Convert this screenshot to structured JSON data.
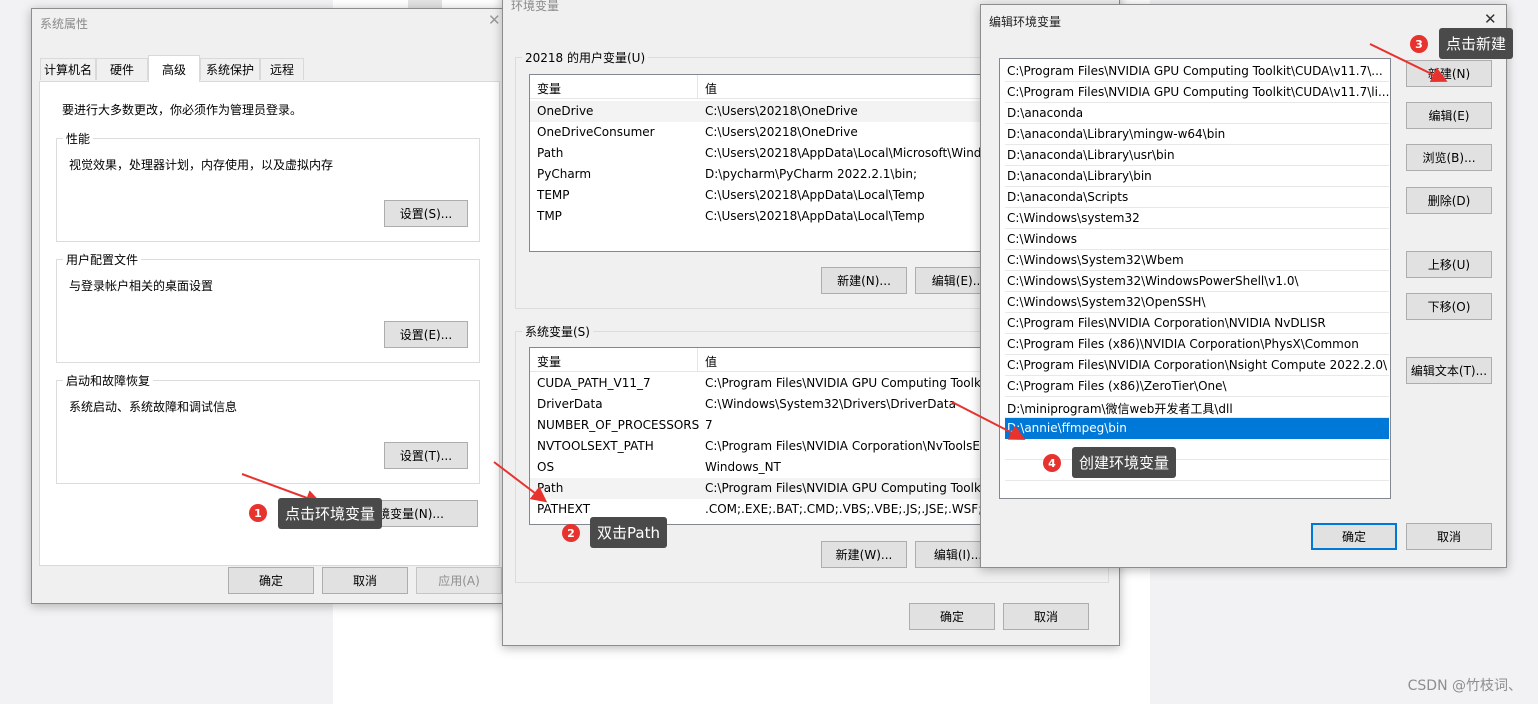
{
  "colors": {
    "accent": "#0078d7",
    "annotation_red": "#e7322d",
    "callout_bg": "#4a4a4a"
  },
  "sys_props": {
    "title": "系统属性",
    "tabs": [
      "计算机名",
      "硬件",
      "高级",
      "系统保护",
      "远程"
    ],
    "active_tab": "高级",
    "admin_note": "要进行大多数更改，你必须作为管理员登录。",
    "performance": {
      "label": "性能",
      "desc": "视觉效果，处理器计划，内存使用，以及虚拟内存",
      "button": "设置(S)..."
    },
    "user_profiles": {
      "label": "用户配置文件",
      "desc": "与登录帐户相关的桌面设置",
      "button": "设置(E)..."
    },
    "startup": {
      "label": "启动和故障恢复",
      "desc": "系统启动、系统故障和调试信息",
      "button": "设置(T)..."
    },
    "env_button": "环境变量(N)...",
    "ok": "确定",
    "cancel": "取消",
    "apply": "应用(A)"
  },
  "env_vars": {
    "title": "环境变量",
    "user_group": "20218 的用户变量(U)",
    "system_group": "系统变量(S)",
    "col_var": "变量",
    "col_val": "值",
    "user_rows": [
      {
        "name": "OneDrive",
        "value": "C:\\Users\\20218\\OneDrive"
      },
      {
        "name": "OneDriveConsumer",
        "value": "C:\\Users\\20218\\OneDrive"
      },
      {
        "name": "Path",
        "value": "C:\\Users\\20218\\AppData\\Local\\Microsoft\\Wind"
      },
      {
        "name": "PyCharm",
        "value": "D:\\pycharm\\PyCharm 2022.2.1\\bin;"
      },
      {
        "name": "TEMP",
        "value": "C:\\Users\\20218\\AppData\\Local\\Temp"
      },
      {
        "name": "TMP",
        "value": "C:\\Users\\20218\\AppData\\Local\\Temp"
      }
    ],
    "system_rows": [
      {
        "name": "CUDA_PATH_V11_7",
        "value": "C:\\Program Files\\NVIDIA GPU Computing Toolk"
      },
      {
        "name": "DriverData",
        "value": "C:\\Windows\\System32\\Drivers\\DriverData"
      },
      {
        "name": "NUMBER_OF_PROCESSORS",
        "value": "7"
      },
      {
        "name": "NVTOOLSEXT_PATH",
        "value": "C:\\Program Files\\NVIDIA Corporation\\NvToolsE"
      },
      {
        "name": "OS",
        "value": "Windows_NT"
      },
      {
        "name": "Path",
        "value": "C:\\Program Files\\NVIDIA GPU Computing Toolk"
      },
      {
        "name": "PATHEXT",
        "value": ".COM;.EXE;.BAT;.CMD;.VBS;.VBE;.JS;.JSE;.WSF;.WS"
      }
    ],
    "user_new": "新建(N)...",
    "user_edit": "编辑(E)...",
    "sys_new": "新建(W)...",
    "sys_edit": "编辑(I)...",
    "ok": "确定",
    "cancel": "取消"
  },
  "edit_env": {
    "title": "编辑环境变量",
    "paths": [
      "C:\\Program Files\\NVIDIA GPU Computing Toolkit\\CUDA\\v11.7\\...",
      "C:\\Program Files\\NVIDIA GPU Computing Toolkit\\CUDA\\v11.7\\li...",
      "D:\\anaconda",
      "D:\\anaconda\\Library\\mingw-w64\\bin",
      "D:\\anaconda\\Library\\usr\\bin",
      "D:\\anaconda\\Library\\bin",
      "D:\\anaconda\\Scripts",
      "C:\\Windows\\system32",
      "C:\\Windows",
      "C:\\Windows\\System32\\Wbem",
      "C:\\Windows\\System32\\WindowsPowerShell\\v1.0\\",
      "C:\\Windows\\System32\\OpenSSH\\",
      "C:\\Program Files\\NVIDIA Corporation\\NVIDIA NvDLISR",
      "C:\\Program Files (x86)\\NVIDIA Corporation\\PhysX\\Common",
      "C:\\Program Files\\NVIDIA Corporation\\Nsight Compute 2022.2.0\\",
      "C:\\Program Files (x86)\\ZeroTier\\One\\",
      "D:\\miniprogram\\微信web开发者工具\\dll",
      "D:\\annie\\ffmpeg\\bin"
    ],
    "selected_index": 17,
    "buttons": {
      "new": "新建(N)",
      "edit": "编辑(E)",
      "browse": "浏览(B)...",
      "delete": "删除(D)",
      "up": "上移(U)",
      "down": "下移(O)",
      "edit_text": "编辑文本(T)..."
    },
    "ok": "确定",
    "cancel": "取消"
  },
  "annotations": [
    {
      "num": "1",
      "text": "点击环境变量"
    },
    {
      "num": "2",
      "text": "双击Path"
    },
    {
      "num": "3",
      "text": "点击新建"
    },
    {
      "num": "4",
      "text": "创建环境变量"
    }
  ],
  "watermark": "CSDN @竹枝词、"
}
